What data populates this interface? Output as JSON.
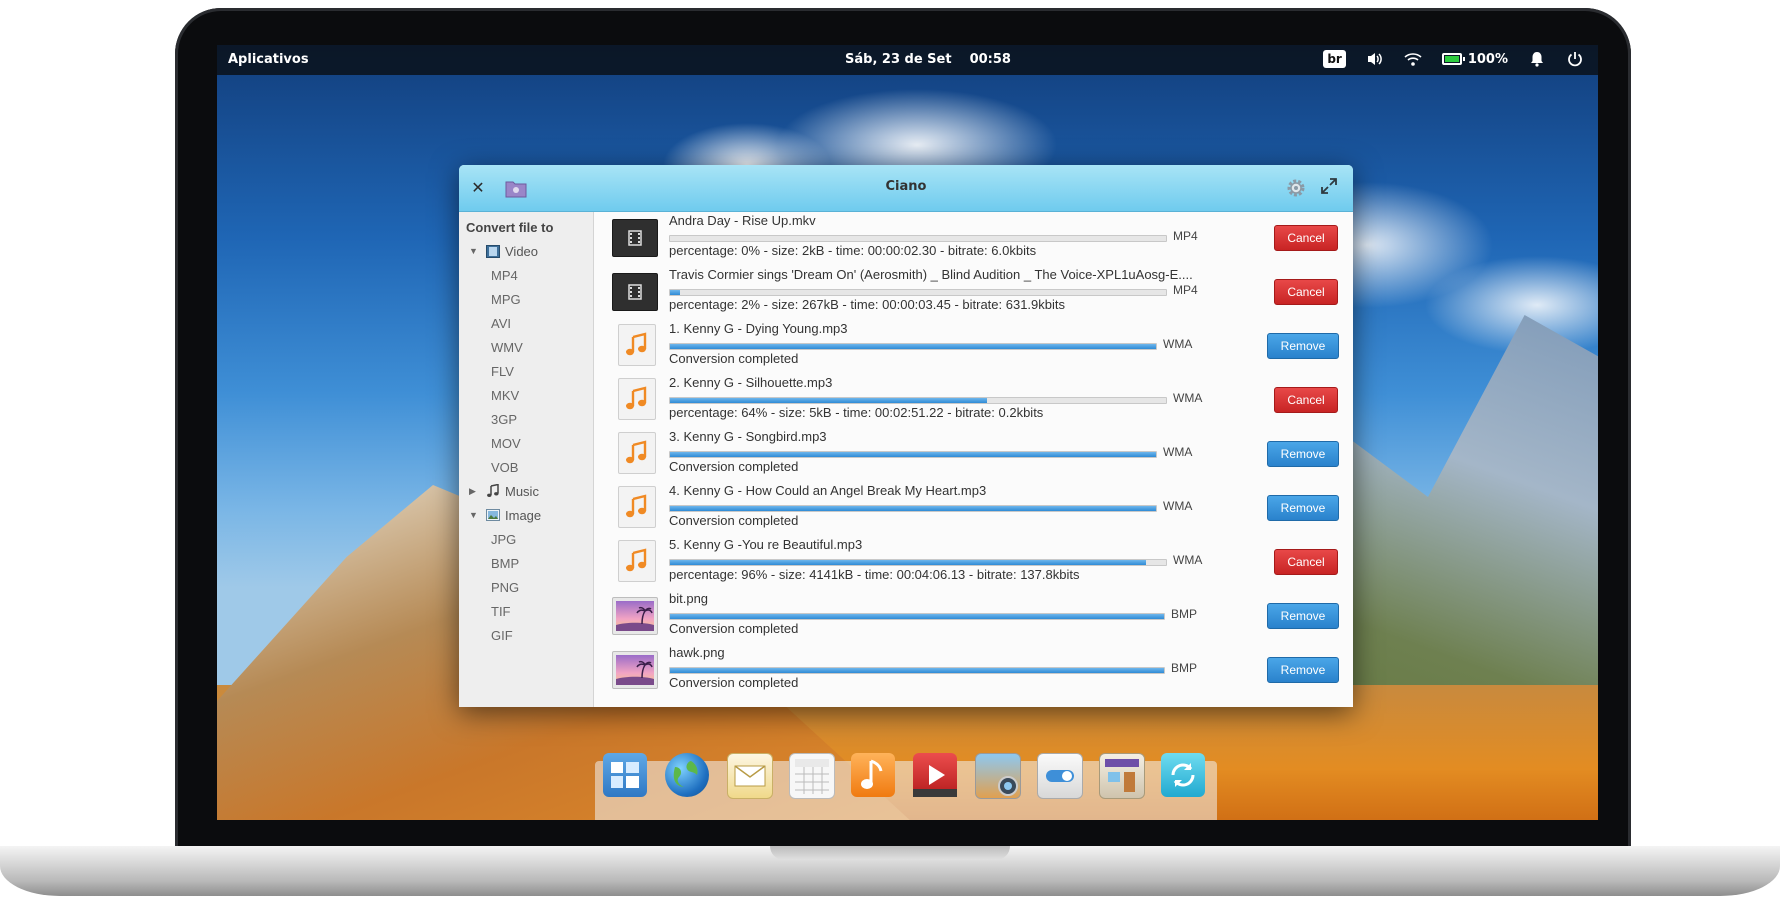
{
  "panel": {
    "apps_label": "Aplicativos",
    "date": "Sáb, 23 de Set",
    "time": "00:58",
    "keyboard_layout": "br",
    "battery_percent": "100%"
  },
  "window": {
    "title": "Ciano"
  },
  "sidebar": {
    "heading": "Convert file to",
    "video": {
      "label": "Video",
      "formats": [
        "MP4",
        "MPG",
        "AVI",
        "WMV",
        "FLV",
        "MKV",
        "3GP",
        "MOV",
        "VOB"
      ]
    },
    "music": {
      "label": "Music"
    },
    "image": {
      "label": "Image",
      "formats": [
        "JPG",
        "BMP",
        "PNG",
        "TIF",
        "GIF"
      ]
    }
  },
  "items": [
    {
      "type": "video",
      "name": "Andra Day - Rise Up.mkv",
      "status": "percentage: 0% - size: 2kB - time: 00:00:02.30 - bitrate: 6.0kbits",
      "format": "MP4",
      "action": "Cancel",
      "progress": 0.0
    },
    {
      "type": "video",
      "name": "Travis Cormier sings 'Dream On' (Aerosmith) _ Blind Audition _ The Voice-XPL1uAosg-E....",
      "status": "percentage: 2% - size: 267kB - time: 00:00:03.45 - bitrate: 631.9kbits",
      "format": "MP4",
      "action": "Cancel",
      "progress": 0.02
    },
    {
      "type": "audio",
      "name": "1. Kenny G - Dying Young.mp3",
      "status": "Conversion completed",
      "format": "WMA",
      "action": "Remove",
      "progress": 1.0
    },
    {
      "type": "audio",
      "name": "2. Kenny G - Silhouette.mp3",
      "status": "percentage: 64% - size: 5kB - time: 00:02:51.22 - bitrate: 0.2kbits",
      "format": "WMA",
      "action": "Cancel",
      "progress": 0.64
    },
    {
      "type": "audio",
      "name": "3. Kenny G - Songbird.mp3",
      "status": "Conversion completed",
      "format": "WMA",
      "action": "Remove",
      "progress": 1.0
    },
    {
      "type": "audio",
      "name": "4. Kenny G - How Could an Angel Break My Heart.mp3",
      "status": "Conversion completed",
      "format": "WMA",
      "action": "Remove",
      "progress": 1.0
    },
    {
      "type": "audio",
      "name": "5. Kenny G -You re Beautiful.mp3",
      "status": "percentage: 96% - size: 4141kB - time: 00:04:06.13 - bitrate: 137.8kbits",
      "format": "WMA",
      "action": "Cancel",
      "progress": 0.96
    },
    {
      "type": "image",
      "name": "bit.png",
      "status": "Conversion completed",
      "format": "BMP",
      "action": "Remove",
      "progress": 1.0
    },
    {
      "type": "image",
      "name": "hawk.png",
      "status": "Conversion completed",
      "format": "BMP",
      "action": "Remove",
      "progress": 1.0
    }
  ],
  "dock": {
    "apps": [
      "multitasking-view-icon",
      "web-browser-icon",
      "mail-icon",
      "calendar-icon",
      "music-icon",
      "videos-icon",
      "photos-icon",
      "settings-icon",
      "app-center-icon",
      "ciano-converter-icon"
    ]
  },
  "colors": {
    "titlebar": "#6fcbee",
    "cancel": "#c82424",
    "remove": "#2a82cc",
    "progress": "#2f8bd6"
  }
}
